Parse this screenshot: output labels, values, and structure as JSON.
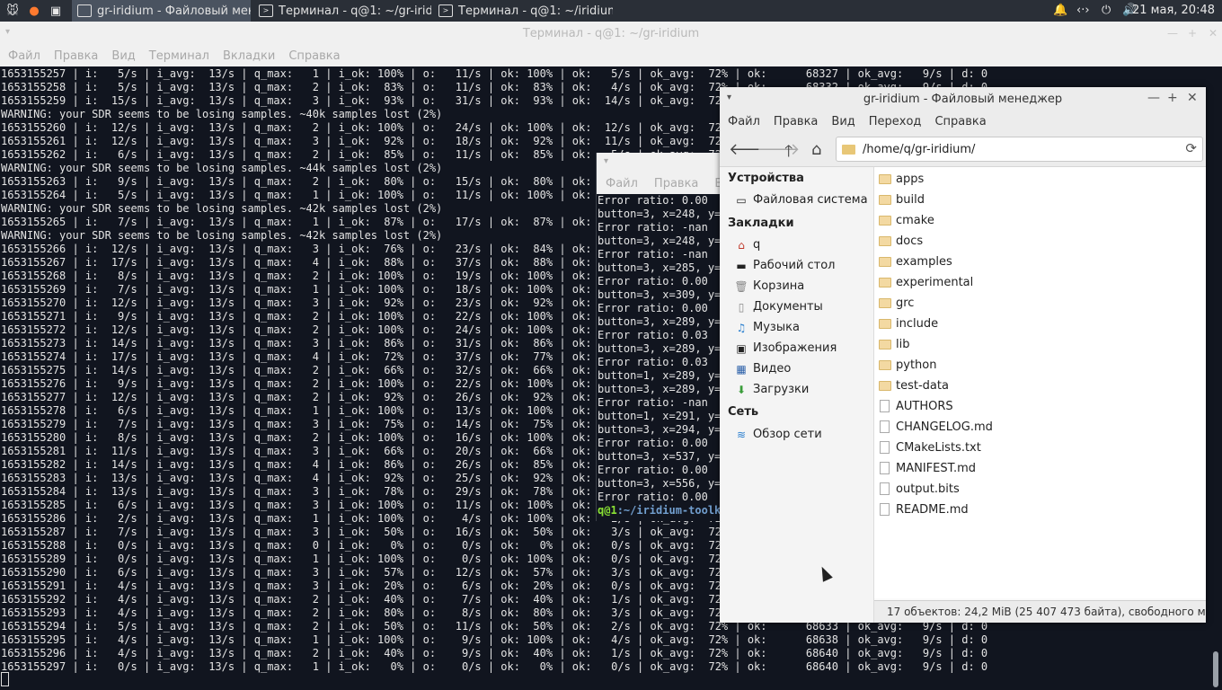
{
  "panel": {
    "tasks": [
      {
        "label": "gr-iridium - Файловый менеджер"
      },
      {
        "label": "Терминал - q@1: ~/gr-iridium"
      },
      {
        "label": "Терминал - q@1: ~/iridium-..."
      }
    ],
    "clock": "21 мая, 20:48"
  },
  "terminal": {
    "title": "Терминал - q@1: ~/gr-iridium",
    "menu": [
      "Файл",
      "Правка",
      "Вид",
      "Терминал",
      "Вкладки",
      "Справка"
    ],
    "lines": [
      "1653155257 | i:   5/s | i_avg:  13/s | q_max:   1 | i_ok: 100% | o:   11/s | ok: 100% | ok:   5/s | ok_avg:  72% | ok:      68327 | ok_avg:   9/s | d: 0",
      "1653155258 | i:   5/s | i_avg:  13/s | q_max:   2 | i_ok:  83% | o:   11/s | ok:  83% | ok:   4/s | ok_avg:  72% | ok:      68332 | ok_avg:   9/s | d: 0",
      "1653155259 | i:  15/s | i_avg:  13/s | q_max:   3 | i_ok:  93% | o:   31/s | ok:  93% | ok:  14/s | ok_avg:  72% | ok:      68346 | ok_avg:   9/s | d: 0",
      "WARNING: your SDR seems to be losing samples. ~40k samples lost (2%)",
      "1653155260 | i:  12/s | i_avg:  13/s | q_max:   2 | i_ok: 100% | o:   24/s | ok: 100% | ok:  12/s | ok_avg:  72% | ok:      68358 | ok_avg:   9/s | d: 0",
      "1653155261 | i:  12/s | i_avg:  13/s | q_max:   3 | i_ok:  92% | o:   18/s | ok:  92% | ok:  11/s | ok_avg:  72% | ok:      68369 | ok_avg:   9/s | d: 0",
      "1653155262 | i:   6/s | i_avg:  13/s | q_max:   2 | i_ok:  85% | o:   11/s | ok:  85% | ok:   5/s | ok_avg:  72% | ok:      68374 | ok_avg:   9/s | d: 0",
      "WARNING: your SDR seems to be losing samples. ~44k samples lost (2%)",
      "1653155263 | i:   9/s | i_avg:  13/s | q_max:   2 | i_ok:  80% | o:   15/s | ok:  80% | ok:   7/s | ok_avg:  72% | ok:      68381 | ok_avg:   9/s | d: 0",
      "1653155264 | i:   5/s | i_avg:  13/s | q_max:   1 | i_ok: 100% | o:   11/s | ok: 100% | ok:   5/s | ok_avg:  72% | ok:      68386 | ok_avg:   9/s | d: 0",
      "WARNING: your SDR seems to be losing samples. ~42k samples lost (2%)",
      "1653155265 | i:   7/s | i_avg:  13/s | q_max:   1 | i_ok:  87% | o:   17/s | ok:  87% | ok:   6/s | ok_avg:  72% | ok:      68392 | ok_avg:   9/s | d: 0",
      "WARNING: your SDR seems to be losing samples. ~42k samples lost (2%)",
      "1653155266 | i:  12/s | i_avg:  13/s | q_max:   3 | i_ok:  76% | o:   23/s | ok:  84% | ok:  10/s | ok_avg:  72% | ok:      68402 | ok_avg:   9/s | d: 0",
      "1653155267 | i:  17/s | i_avg:  13/s | q_max:   4 | i_ok:  88% | o:   37/s | ok:  88% | ok:  15/s | ok_avg:  72% | ok:      68417 | ok_avg:   9/s | d: 0",
      "1653155268 | i:   8/s | i_avg:  13/s | q_max:   2 | i_ok: 100% | o:   19/s | ok: 100% | ok:   8/s | ok_avg:  72% | ok:      68425 | ok_avg:   9/s | d: 0",
      "1653155269 | i:   7/s | i_avg:  13/s | q_max:   1 | i_ok: 100% | o:   18/s | ok: 100% | ok:   7/s | ok_avg:  72% | ok:      68432 | ok_avg:   9/s | d: 0",
      "1653155270 | i:  12/s | i_avg:  13/s | q_max:   3 | i_ok:  92% | o:   23/s | ok:  92% | ok:  11/s | ok_avg:  72% | ok:      68443 | ok_avg:   9/s | d: 0",
      "1653155271 | i:   9/s | i_avg:  13/s | q_max:   2 | i_ok: 100% | o:   22/s | ok: 100% | ok:   9/s | ok_avg:  72% | ok:      68452 | ok_avg:   9/s | d: 0",
      "1653155272 | i:  12/s | i_avg:  13/s | q_max:   2 | i_ok: 100% | o:   24/s | ok: 100% | ok:  12/s | ok_avg:  72% | ok:      68464 | ok_avg:   9/s | d: 0",
      "1653155273 | i:  14/s | i_avg:  13/s | q_max:   3 | i_ok:  86% | o:   31/s | ok:  86% | ok:  12/s | ok_avg:  72% | ok:      68476 | ok_avg:   9/s | d: 0",
      "1653155274 | i:  17/s | i_avg:  13/s | q_max:   4 | i_ok:  72% | o:   37/s | ok:  77% | ok:  13/s | ok_avg:  72% | ok:      68489 | ok_avg:   9/s | d: 0",
      "1653155275 | i:  14/s | i_avg:  13/s | q_max:   2 | i_ok:  66% | o:   32/s | ok:  66% | ok:   9/s | ok_avg:  72% | ok:      68498 | ok_avg:   9/s | d: 0",
      "1653155276 | i:   9/s | i_avg:  13/s | q_max:   2 | i_ok: 100% | o:   22/s | ok: 100% | ok:   9/s | ok_avg:  72% | ok:      68507 | ok_avg:   9/s | d: 0",
      "1653155277 | i:  12/s | i_avg:  13/s | q_max:   2 | i_ok:  92% | o:   26/s | ok:  92% | ok:  11/s | ok_avg:  72% | ok:      68518 | ok_avg:   9/s | d: 0",
      "1653155278 | i:   6/s | i_avg:  13/s | q_max:   1 | i_ok: 100% | o:   13/s | ok: 100% | ok:   6/s | ok_avg:  72% | ok:      68524 | ok_avg:   9/s | d: 0",
      "1653155279 | i:   7/s | i_avg:  13/s | q_max:   3 | i_ok:  75% | o:   14/s | ok:  75% | ok:   5/s | ok_avg:  72% | ok:      68529 | ok_avg:   9/s | d: 0",
      "1653155280 | i:   8/s | i_avg:  13/s | q_max:   2 | i_ok: 100% | o:   16/s | ok: 100% | ok:   8/s | ok_avg:  72% | ok:      68537 | ok_avg:   9/s | d: 0",
      "1653155281 | i:  11/s | i_avg:  13/s | q_max:   3 | i_ok:  66% | o:   20/s | ok:  66% | ok:   7/s | ok_avg:  72% | ok:      68544 | ok_avg:   9/s | d: 0",
      "1653155282 | i:  14/s | i_avg:  13/s | q_max:   4 | i_ok:  86% | o:   26/s | ok:  85% | ok:  12/s | ok_avg:  72% | ok:      68556 | ok_avg:   9/s | d: 0",
      "1653155283 | i:  13/s | i_avg:  13/s | q_max:   4 | i_ok:  92% | o:   25/s | ok:  92% | ok:  12/s | ok_avg:  72% | ok:      68568 | ok_avg:   9/s | d: 0",
      "1653155284 | i:  13/s | i_avg:  13/s | q_max:   3 | i_ok:  78% | o:   29/s | ok:  78% | ok:  10/s | ok_avg:  72% | ok:      68578 | ok_avg:   9/s | d: 0",
      "1653155285 | i:   6/s | i_avg:  13/s | q_max:   3 | i_ok: 100% | o:   11/s | ok: 100% | ok:   6/s | ok_avg:  72% | ok:      68584 | ok_avg:   9/s | d: 0",
      "1653155286 | i:   2/s | i_avg:  13/s | q_max:   1 | i_ok: 100% | o:    4/s | ok: 100% | ok:   2/s | ok_avg:  72% | ok:      68586 | ok_avg:   9/s | d: 0",
      "1653155287 | i:   7/s | i_avg:  13/s | q_max:   3 | i_ok:  50% | o:   16/s | ok:  50% | ok:   3/s | ok_avg:  72% | ok:      68589 | ok_avg:   9/s | d: 0",
      "1653155288 | i:   0/s | i_avg:  13/s | q_max:   0 | i_ok:   0% | o:    0/s | ok:   0% | ok:   0/s | ok_avg:  72% | ok:      68589 | ok_avg:   9/s | d: 0",
      "1653155289 | i:   0/s | i_avg:  13/s | q_max:   1 | i_ok: 100% | o:    0/s | ok: 100% | ok:   0/s | ok_avg:  72% | ok:      68590 | ok_avg:   9/s | d: 0",
      "1653155290 | i:   6/s | i_avg:  13/s | q_max:   3 | i_ok:  57% | o:   12/s | ok:  57% | ok:   3/s | ok_avg:  72% | ok:      68593 | ok_avg:   9/s | d: 0",
      "1653155291 | i:   4/s | i_avg:  13/s | q_max:   3 | i_ok:  20% | o:    6/s | ok:  20% | ok:   0/s | ok_avg:  72% | ok:      68594 | ok_avg:   9/s | d: 0",
      "1653155292 | i:   4/s | i_avg:  13/s | q_max:   2 | i_ok:  40% | o:    7/s | ok:  40% | ok:   1/s | ok_avg:  72% | ok:      68596 | ok_avg:   9/s | d: 0",
      "1653155293 | i:   4/s | i_avg:  13/s | q_max:   2 | i_ok:  80% | o:    8/s | ok:  80% | ok:   3/s | ok_avg:  72% | ok:      68600 | ok_avg:   9/s | d: 0",
      "1653155294 | i:   5/s | i_avg:  13/s | q_max:   2 | i_ok:  50% | o:   11/s | ok:  50% | ok:   2/s | ok_avg:  72% | ok:      68633 | ok_avg:   9/s | d: 0",
      "1653155295 | i:   4/s | i_avg:  13/s | q_max:   1 | i_ok: 100% | o:    9/s | ok: 100% | ok:   4/s | ok_avg:  72% | ok:      68638 | ok_avg:   9/s | d: 0",
      "1653155296 | i:   4/s | i_avg:  13/s | q_max:   2 | i_ok:  40% | o:    9/s | ok:  40% | ok:   1/s | ok_avg:  72% | ok:      68640 | ok_avg:   9/s | d: 0",
      "1653155297 | i:   0/s | i_avg:  13/s | q_max:   1 | i_ok:   0% | o:    0/s | ok:   0% | ok:   0/s | ok_avg:  72% | ok:      68640 | ok_avg:   9/s | d: 0"
    ]
  },
  "terminal2": {
    "menu": [
      "Файл",
      "Правка",
      "Ви"
    ],
    "lines": [
      "Error ratio: 0.00",
      "button=3, x=248, y=3",
      "Error ratio: -nan",
      "button=3, x=248, y=3",
      "Error ratio: -nan",
      "button=3, x=285, y=4",
      "Error ratio: 0.00",
      "button=3, x=309, y=3",
      "Error ratio: 0.00",
      "button=3, x=289, y=3",
      "Error ratio: 0.03",
      "button=3, x=289, y=3",
      "Error ratio: 0.03",
      "button=1, x=289, y=3",
      "button=3, x=289, y=3",
      "Error ratio: -nan",
      "button=1, x=291, y=2",
      "button=3, x=294, y=2",
      "Error ratio: 0.00",
      "button=3, x=537, y=3",
      "Error ratio: 0.00",
      "button=3, x=556, y=3",
      "Error ratio: 0.00"
    ],
    "prompt_user": "q@1",
    "prompt_path": ":~/iridium-toolki"
  },
  "filemanager": {
    "title": "gr-iridium - Файловый менеджер",
    "menu": [
      "Файл",
      "Правка",
      "Вид",
      "Переход",
      "Справка"
    ],
    "path": "/home/q/gr-iridium/",
    "side": {
      "devices_header": "Устройства",
      "filesystem": "Файловая система",
      "bookmarks_header": "Закладки",
      "bookmarks": [
        "q",
        "Рабочий стол",
        "Корзина",
        "Документы",
        "Музыка",
        "Изображения",
        "Видео",
        "Загрузки"
      ],
      "network_header": "Сеть",
      "network_browse": "Обзор сети"
    },
    "folders": [
      "apps",
      "build",
      "cmake",
      "docs",
      "examples",
      "experimental",
      "grc",
      "include",
      "lib",
      "python",
      "test-data"
    ],
    "files": [
      "AUTHORS",
      "CHANGELOG.md",
      "CMakeLists.txt",
      "MANIFEST.md",
      "output.bits",
      "README.md"
    ],
    "status": "17 объектов: 24,2 MiB (25 407 473 байта), свободного ме..."
  }
}
